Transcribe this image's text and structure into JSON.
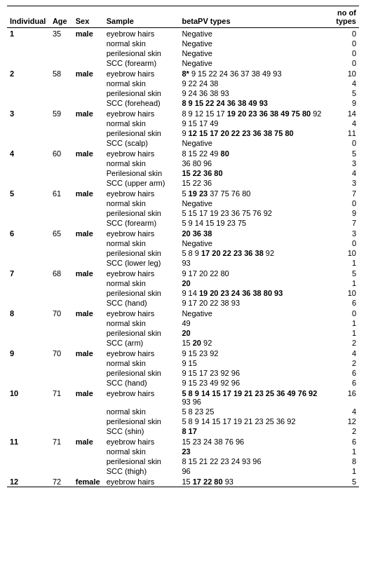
{
  "table": {
    "headers": {
      "individual": "Individual",
      "age": "Age",
      "sex": "Sex",
      "sample": "Sample",
      "betaPV": "betaPV types",
      "noOfTypes": "no of types"
    },
    "rows": [
      {
        "individual": "1",
        "age": "35",
        "sex": "male",
        "sample": "eyebrow hairs",
        "betaPV": "Negative",
        "noOfTypes": "0",
        "bold_parts": []
      },
      {
        "individual": "",
        "age": "",
        "sex": "",
        "sample": "normal skin",
        "betaPV": "Negative",
        "noOfTypes": "0",
        "bold_parts": []
      },
      {
        "individual": "",
        "age": "",
        "sex": "",
        "sample": "perilesional skin",
        "betaPV": "Negative",
        "noOfTypes": "0",
        "bold_parts": []
      },
      {
        "individual": "",
        "age": "",
        "sex": "",
        "sample": "SCC (forearm)",
        "betaPV": "Negative",
        "noOfTypes": "0",
        "bold_parts": []
      },
      {
        "individual": "2",
        "age": "58",
        "sex": "male",
        "sample": "eyebrow hairs",
        "betaPV": "8* 9 15 22 24 36 37 38 49 93",
        "noOfTypes": "10",
        "bold_parts": [
          "8*"
        ]
      },
      {
        "individual": "",
        "age": "",
        "sex": "",
        "sample": "normal skin",
        "betaPV": "9 22 24 38",
        "noOfTypes": "4",
        "bold_parts": []
      },
      {
        "individual": "",
        "age": "",
        "sex": "",
        "sample": "perilesional skin",
        "betaPV": "9 24 36 38 93",
        "noOfTypes": "5",
        "bold_parts": []
      },
      {
        "individual": "",
        "age": "",
        "sex": "",
        "sample": "SCC (forehead)",
        "betaPV": "8 9 15 22 24 36 38 49 93",
        "noOfTypes": "9",
        "bold_parts": [
          "8",
          "9",
          "15",
          "22",
          "24",
          "36",
          "38",
          "49",
          "93"
        ]
      },
      {
        "individual": "3",
        "age": "59",
        "sex": "male",
        "sample": "eyebrow hairs",
        "betaPV": "8 9 12 15 17 19 20 23 36 38 49 75 80 92",
        "noOfTypes": "14",
        "bold_parts": [
          "19",
          "20",
          "23",
          "36",
          "38",
          "49",
          "75",
          "80"
        ]
      },
      {
        "individual": "",
        "age": "",
        "sex": "",
        "sample": "normal skin",
        "betaPV": "9 15 17 49",
        "noOfTypes": "4",
        "bold_parts": []
      },
      {
        "individual": "",
        "age": "",
        "sex": "",
        "sample": "perilesional skin",
        "betaPV": "9 12 15 17 20 22 23 36 38 75 80",
        "noOfTypes": "11",
        "bold_parts": [
          "12",
          "15",
          "17",
          "20",
          "22",
          "23",
          "36",
          "38",
          "75",
          "80"
        ]
      },
      {
        "individual": "",
        "age": "",
        "sex": "",
        "sample": "SCC (scalp)",
        "betaPV": "Negative",
        "noOfTypes": "0",
        "bold_parts": []
      },
      {
        "individual": "4",
        "age": "60",
        "sex": "male",
        "sample": "eyebrow hairs",
        "betaPV": "8 15 22 49 80",
        "noOfTypes": "5",
        "bold_parts": [
          "80"
        ]
      },
      {
        "individual": "",
        "age": "",
        "sex": "",
        "sample": "normal skin",
        "betaPV": "36 80 96",
        "noOfTypes": "3",
        "bold_parts": []
      },
      {
        "individual": "",
        "age": "",
        "sex": "",
        "sample": "Perilesional skin",
        "betaPV": "15 22 36 80",
        "noOfTypes": "4",
        "bold_parts": [
          "15",
          "22",
          "36",
          "80"
        ]
      },
      {
        "individual": "",
        "age": "",
        "sex": "",
        "sample": "SCC (upper arm)",
        "betaPV": "15 22 36",
        "noOfTypes": "3",
        "bold_parts": []
      },
      {
        "individual": "5",
        "age": "61",
        "sex": "male",
        "sample": "eyebrow hairs",
        "betaPV": "5 19 23 37 75 76 80",
        "noOfTypes": "7",
        "bold_parts": [
          "19",
          "23"
        ]
      },
      {
        "individual": "",
        "age": "",
        "sex": "",
        "sample": "normal skin",
        "betaPV": "Negative",
        "noOfTypes": "0",
        "bold_parts": []
      },
      {
        "individual": "",
        "age": "",
        "sex": "",
        "sample": "perilesional skin",
        "betaPV": "5 15 17 19 23 36 75 76 92",
        "noOfTypes": "9",
        "bold_parts": []
      },
      {
        "individual": "",
        "age": "",
        "sex": "",
        "sample": "SCC (forearm)",
        "betaPV": "5 9 14 15 19 23 75",
        "noOfTypes": "7",
        "bold_parts": []
      },
      {
        "individual": "6",
        "age": "65",
        "sex": "male",
        "sample": "eyebrow hairs",
        "betaPV": "20 36 38",
        "noOfTypes": "3",
        "bold_parts": [
          "20",
          "36",
          "38"
        ]
      },
      {
        "individual": "",
        "age": "",
        "sex": "",
        "sample": "normal skin",
        "betaPV": "Negative",
        "noOfTypes": "0",
        "bold_parts": []
      },
      {
        "individual": "",
        "age": "",
        "sex": "",
        "sample": "perilesional skin",
        "betaPV": "5 8 9 17 20 22 23 36 38 92",
        "noOfTypes": "10",
        "bold_parts": [
          "17",
          "20",
          "22",
          "23",
          "36",
          "38"
        ]
      },
      {
        "individual": "",
        "age": "",
        "sex": "",
        "sample": "SCC (lower leg)",
        "betaPV": "93",
        "noOfTypes": "1",
        "bold_parts": []
      },
      {
        "individual": "7",
        "age": "68",
        "sex": "male",
        "sample": "eyebrow hairs",
        "betaPV": "9 17 20 22 80",
        "noOfTypes": "5",
        "bold_parts": []
      },
      {
        "individual": "",
        "age": "",
        "sex": "",
        "sample": "normal skin",
        "betaPV": "20",
        "noOfTypes": "1",
        "bold_parts": [
          "20"
        ]
      },
      {
        "individual": "",
        "age": "",
        "sex": "",
        "sample": "perilesional skin",
        "betaPV": "9 14 19 20 23 24 36 38 80 93",
        "noOfTypes": "10",
        "bold_parts": [
          "19",
          "20",
          "23",
          "24",
          "36",
          "38",
          "80",
          "93"
        ]
      },
      {
        "individual": "",
        "age": "",
        "sex": "",
        "sample": "SCC (hand)",
        "betaPV": "9 17 20 22 38 93",
        "noOfTypes": "6",
        "bold_parts": []
      },
      {
        "individual": "8",
        "age": "70",
        "sex": "male",
        "sample": "eyebrow hairs",
        "betaPV": "Negative",
        "noOfTypes": "0",
        "bold_parts": []
      },
      {
        "individual": "",
        "age": "",
        "sex": "",
        "sample": "normal skin",
        "betaPV": "49",
        "noOfTypes": "1",
        "bold_parts": []
      },
      {
        "individual": "",
        "age": "",
        "sex": "",
        "sample": "perilesional skin",
        "betaPV": "20",
        "noOfTypes": "1",
        "bold_parts": [
          "20"
        ]
      },
      {
        "individual": "",
        "age": "",
        "sex": "",
        "sample": "SCC (arm)",
        "betaPV": "15 20 92",
        "noOfTypes": "2",
        "bold_parts": [
          "20"
        ]
      },
      {
        "individual": "9",
        "age": "70",
        "sex": "male",
        "sample": "eyebrow hairs",
        "betaPV": "9 15 23 92",
        "noOfTypes": "4",
        "bold_parts": []
      },
      {
        "individual": "",
        "age": "",
        "sex": "",
        "sample": "normal skin",
        "betaPV": "9 15",
        "noOfTypes": "2",
        "bold_parts": []
      },
      {
        "individual": "",
        "age": "",
        "sex": "",
        "sample": "perilesional skin",
        "betaPV": "9 15 17 23 92 96",
        "noOfTypes": "6",
        "bold_parts": []
      },
      {
        "individual": "",
        "age": "",
        "sex": "",
        "sample": "SCC (hand)",
        "betaPV": "9 15 23 49 92 96",
        "noOfTypes": "6",
        "bold_parts": []
      },
      {
        "individual": "10",
        "age": "71",
        "sex": "male",
        "sample": "eyebrow hairs",
        "betaPV": "5 8 9 14 15 17 19 21 23 25 36 49 76 92\n93 96",
        "noOfTypes": "16",
        "bold_parts": [
          "5",
          "8",
          "9",
          "14",
          "15",
          "17",
          "19",
          "21",
          "23",
          "25",
          "36",
          "49",
          "76",
          "92"
        ],
        "multiline": true
      },
      {
        "individual": "",
        "age": "",
        "sex": "",
        "sample": "normal skin",
        "betaPV": "5 8 23 25",
        "noOfTypes": "4",
        "bold_parts": []
      },
      {
        "individual": "",
        "age": "",
        "sex": "",
        "sample": "perilesional skin",
        "betaPV": "5 8 9 14 15 17 19 21 23 25 36 92",
        "noOfTypes": "12",
        "bold_parts": []
      },
      {
        "individual": "",
        "age": "",
        "sex": "",
        "sample": "SCC (shin)",
        "betaPV": "8 17",
        "noOfTypes": "2",
        "bold_parts": [
          "8",
          "17"
        ]
      },
      {
        "individual": "11",
        "age": "71",
        "sex": "male",
        "sample": "eyebrow hairs",
        "betaPV": "15 23 24 38 76 96",
        "noOfTypes": "6",
        "bold_parts": []
      },
      {
        "individual": "",
        "age": "",
        "sex": "",
        "sample": "normal skin",
        "betaPV": "23",
        "noOfTypes": "1",
        "bold_parts": [
          "23"
        ]
      },
      {
        "individual": "",
        "age": "",
        "sex": "",
        "sample": "perilesional skin",
        "betaPV": "8 15 21 22 23 24 93 96",
        "noOfTypes": "8",
        "bold_parts": []
      },
      {
        "individual": "",
        "age": "",
        "sex": "",
        "sample": "SCC (thigh)",
        "betaPV": "96",
        "noOfTypes": "1",
        "bold_parts": []
      },
      {
        "individual": "12",
        "age": "72",
        "sex": "female",
        "sample": "eyebrow hairs",
        "betaPV": "15 17 22 80 93",
        "noOfTypes": "5",
        "bold_parts": [
          "17",
          "22",
          "80"
        ]
      }
    ]
  }
}
